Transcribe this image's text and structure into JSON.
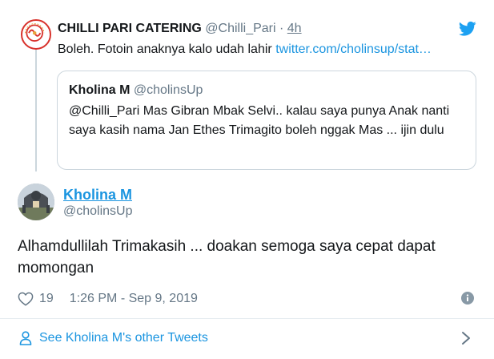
{
  "parent_tweet": {
    "name": "CHILLI PARI CATERING",
    "handle": "@Chilli_Pari",
    "separator": " · ",
    "time": "4h",
    "text": "Boleh. Fotoin anaknya kalo udah lahir ",
    "link": "twitter.com/cholinsup/stat…",
    "icon": "twitter-bird-icon"
  },
  "quoted_tweet": {
    "name": "Kholina M",
    "handle": "@cholinsUp",
    "text": "@Chilli_Pari Mas Gibran Mbak Selvi.. kalau saya punya Anak nanti saya kasih nama Jan Ethes Trimagito boleh nggak Mas ... ijin dulu"
  },
  "tweet": {
    "author_name": "Kholina M",
    "author_handle": "@cholinsUp",
    "text": "Alhamdullilah Trimakasih ... doakan semoga saya cepat dapat momongan",
    "likes": "19",
    "timestamp": "1:26 PM - Sep 9, 2019"
  },
  "footer": {
    "more_tweets_label": "See Kholina M's other Tweets"
  },
  "colors": {
    "link": "#1b95e0",
    "secondary_text": "#657786",
    "border": "#ccd6dd",
    "brand_red": "#d8322c"
  }
}
